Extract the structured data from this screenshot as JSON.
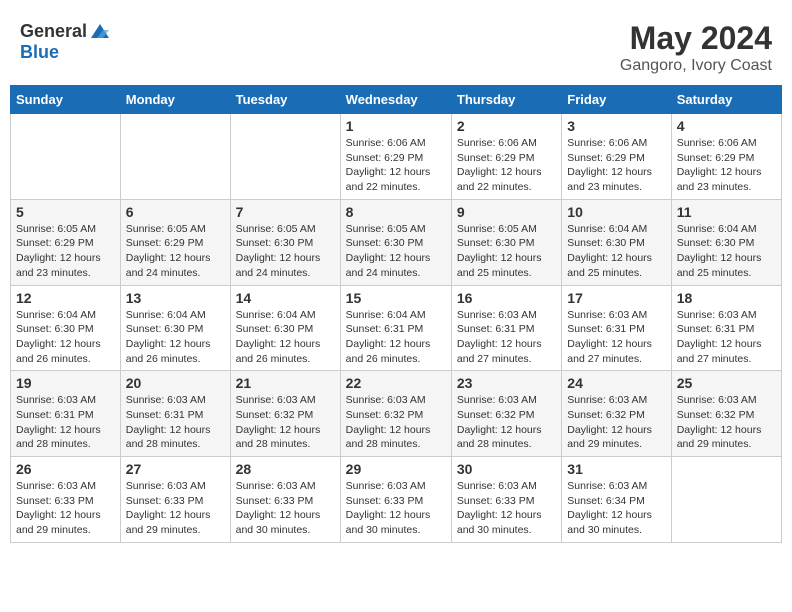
{
  "header": {
    "logo_general": "General",
    "logo_blue": "Blue",
    "month_year": "May 2024",
    "location": "Gangoro, Ivory Coast"
  },
  "days_of_week": [
    "Sunday",
    "Monday",
    "Tuesday",
    "Wednesday",
    "Thursday",
    "Friday",
    "Saturday"
  ],
  "weeks": [
    [
      {
        "day": "",
        "info": ""
      },
      {
        "day": "",
        "info": ""
      },
      {
        "day": "",
        "info": ""
      },
      {
        "day": "1",
        "info": "Sunrise: 6:06 AM\nSunset: 6:29 PM\nDaylight: 12 hours and 22 minutes."
      },
      {
        "day": "2",
        "info": "Sunrise: 6:06 AM\nSunset: 6:29 PM\nDaylight: 12 hours and 22 minutes."
      },
      {
        "day": "3",
        "info": "Sunrise: 6:06 AM\nSunset: 6:29 PM\nDaylight: 12 hours and 23 minutes."
      },
      {
        "day": "4",
        "info": "Sunrise: 6:06 AM\nSunset: 6:29 PM\nDaylight: 12 hours and 23 minutes."
      }
    ],
    [
      {
        "day": "5",
        "info": "Sunrise: 6:05 AM\nSunset: 6:29 PM\nDaylight: 12 hours and 23 minutes."
      },
      {
        "day": "6",
        "info": "Sunrise: 6:05 AM\nSunset: 6:29 PM\nDaylight: 12 hours and 24 minutes."
      },
      {
        "day": "7",
        "info": "Sunrise: 6:05 AM\nSunset: 6:30 PM\nDaylight: 12 hours and 24 minutes."
      },
      {
        "day": "8",
        "info": "Sunrise: 6:05 AM\nSunset: 6:30 PM\nDaylight: 12 hours and 24 minutes."
      },
      {
        "day": "9",
        "info": "Sunrise: 6:05 AM\nSunset: 6:30 PM\nDaylight: 12 hours and 25 minutes."
      },
      {
        "day": "10",
        "info": "Sunrise: 6:04 AM\nSunset: 6:30 PM\nDaylight: 12 hours and 25 minutes."
      },
      {
        "day": "11",
        "info": "Sunrise: 6:04 AM\nSunset: 6:30 PM\nDaylight: 12 hours and 25 minutes."
      }
    ],
    [
      {
        "day": "12",
        "info": "Sunrise: 6:04 AM\nSunset: 6:30 PM\nDaylight: 12 hours and 26 minutes."
      },
      {
        "day": "13",
        "info": "Sunrise: 6:04 AM\nSunset: 6:30 PM\nDaylight: 12 hours and 26 minutes."
      },
      {
        "day": "14",
        "info": "Sunrise: 6:04 AM\nSunset: 6:30 PM\nDaylight: 12 hours and 26 minutes."
      },
      {
        "day": "15",
        "info": "Sunrise: 6:04 AM\nSunset: 6:31 PM\nDaylight: 12 hours and 26 minutes."
      },
      {
        "day": "16",
        "info": "Sunrise: 6:03 AM\nSunset: 6:31 PM\nDaylight: 12 hours and 27 minutes."
      },
      {
        "day": "17",
        "info": "Sunrise: 6:03 AM\nSunset: 6:31 PM\nDaylight: 12 hours and 27 minutes."
      },
      {
        "day": "18",
        "info": "Sunrise: 6:03 AM\nSunset: 6:31 PM\nDaylight: 12 hours and 27 minutes."
      }
    ],
    [
      {
        "day": "19",
        "info": "Sunrise: 6:03 AM\nSunset: 6:31 PM\nDaylight: 12 hours and 28 minutes."
      },
      {
        "day": "20",
        "info": "Sunrise: 6:03 AM\nSunset: 6:31 PM\nDaylight: 12 hours and 28 minutes."
      },
      {
        "day": "21",
        "info": "Sunrise: 6:03 AM\nSunset: 6:32 PM\nDaylight: 12 hours and 28 minutes."
      },
      {
        "day": "22",
        "info": "Sunrise: 6:03 AM\nSunset: 6:32 PM\nDaylight: 12 hours and 28 minutes."
      },
      {
        "day": "23",
        "info": "Sunrise: 6:03 AM\nSunset: 6:32 PM\nDaylight: 12 hours and 28 minutes."
      },
      {
        "day": "24",
        "info": "Sunrise: 6:03 AM\nSunset: 6:32 PM\nDaylight: 12 hours and 29 minutes."
      },
      {
        "day": "25",
        "info": "Sunrise: 6:03 AM\nSunset: 6:32 PM\nDaylight: 12 hours and 29 minutes."
      }
    ],
    [
      {
        "day": "26",
        "info": "Sunrise: 6:03 AM\nSunset: 6:33 PM\nDaylight: 12 hours and 29 minutes."
      },
      {
        "day": "27",
        "info": "Sunrise: 6:03 AM\nSunset: 6:33 PM\nDaylight: 12 hours and 29 minutes."
      },
      {
        "day": "28",
        "info": "Sunrise: 6:03 AM\nSunset: 6:33 PM\nDaylight: 12 hours and 30 minutes."
      },
      {
        "day": "29",
        "info": "Sunrise: 6:03 AM\nSunset: 6:33 PM\nDaylight: 12 hours and 30 minutes."
      },
      {
        "day": "30",
        "info": "Sunrise: 6:03 AM\nSunset: 6:33 PM\nDaylight: 12 hours and 30 minutes."
      },
      {
        "day": "31",
        "info": "Sunrise: 6:03 AM\nSunset: 6:34 PM\nDaylight: 12 hours and 30 minutes."
      },
      {
        "day": "",
        "info": ""
      }
    ]
  ]
}
